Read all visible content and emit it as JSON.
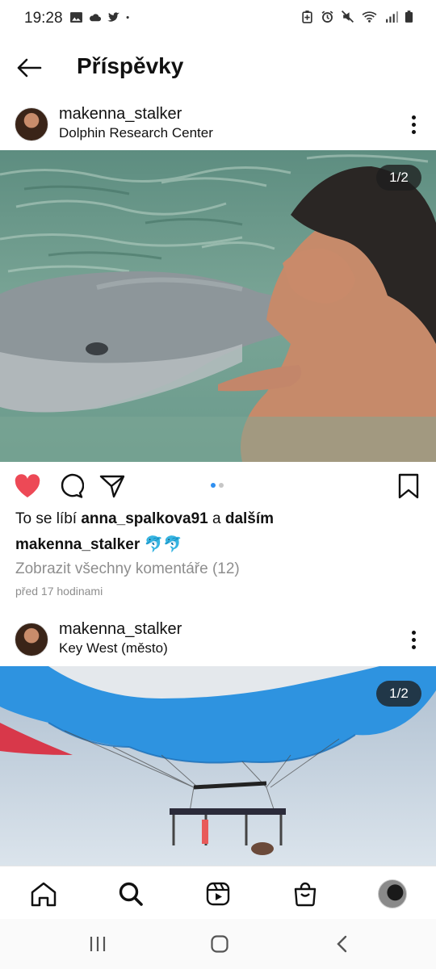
{
  "status_bar": {
    "time": "19:28",
    "left_icons": [
      "image-icon",
      "cloud-icon",
      "twitter-icon",
      "dot-icon"
    ],
    "right_icons": [
      "battery-saver-icon",
      "alarm-icon",
      "mute-icon",
      "wifi-icon",
      "signal-icon",
      "battery-icon"
    ]
  },
  "header": {
    "title": "Příspěvky"
  },
  "posts": [
    {
      "username": "makenna_stalker",
      "location": "Dolphin Research Center",
      "counter": "1/2",
      "liked": true,
      "likes_prefix": "To se líbí",
      "likes_user": "anna_spalkova91",
      "likes_connector": "a",
      "likes_more": "dalším",
      "caption_user": "makenna_stalker",
      "caption_text": "🐬🐬",
      "view_comments": "Zobrazit všechny komentáře (12)",
      "time": "před 17 hodinami"
    },
    {
      "username": "makenna_stalker",
      "location": "Key West (město)",
      "counter": "1/2"
    }
  ],
  "bottom_nav": [
    "home-icon",
    "search-icon",
    "reels-icon",
    "shop-icon",
    "profile-avatar"
  ],
  "colors": {
    "like_red": "#ed4956",
    "dot_blue": "#2f8ff0",
    "muted_text": "#8e8e8e"
  }
}
